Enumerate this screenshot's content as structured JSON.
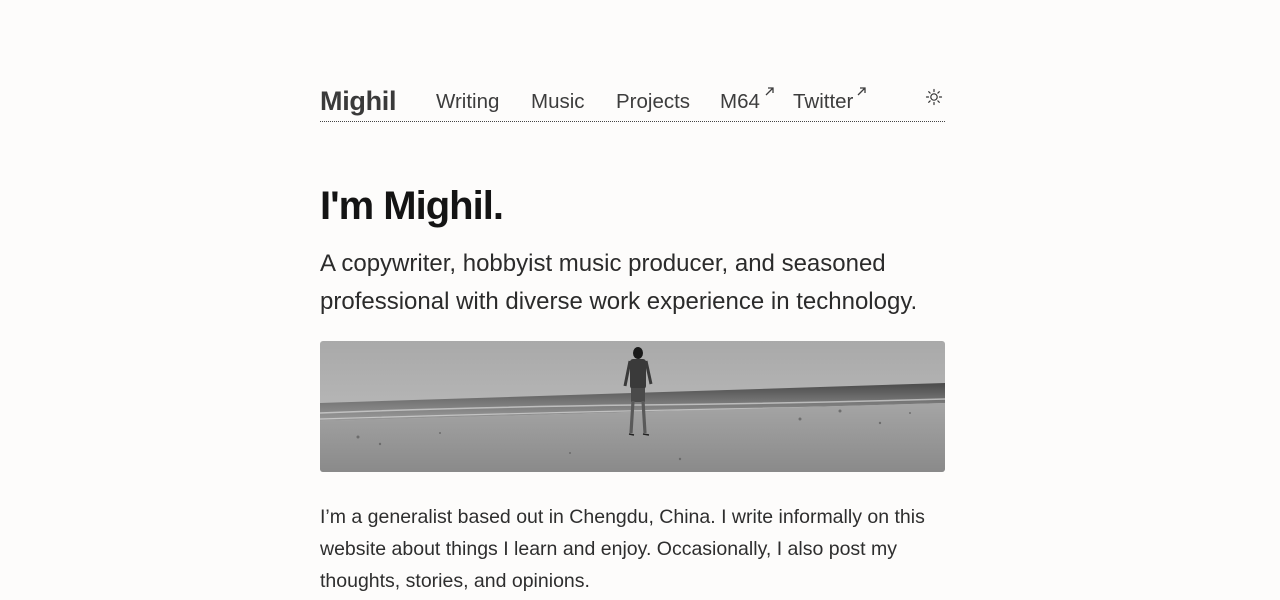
{
  "header": {
    "brand": "Mighil",
    "nav": [
      {
        "label": "Writing",
        "external": false
      },
      {
        "label": "Music",
        "external": false
      },
      {
        "label": "Projects",
        "external": false
      },
      {
        "label": "M64",
        "external": true
      },
      {
        "label": "Twitter",
        "external": true
      }
    ],
    "theme_toggle_icon": "sun-icon"
  },
  "hero": {
    "headline": "I'm Mighil.",
    "tagline": "A copywriter, hobbyist music producer, and seasoned professional with diverse work experience in technology.",
    "photo_icon": "beach-photo"
  },
  "bio": {
    "text": "I’m a generalist based out in Chengdu, China. I write informally on this website about things I learn and enjoy. Occasionally, I also post my thoughts, stories, and opinions."
  }
}
